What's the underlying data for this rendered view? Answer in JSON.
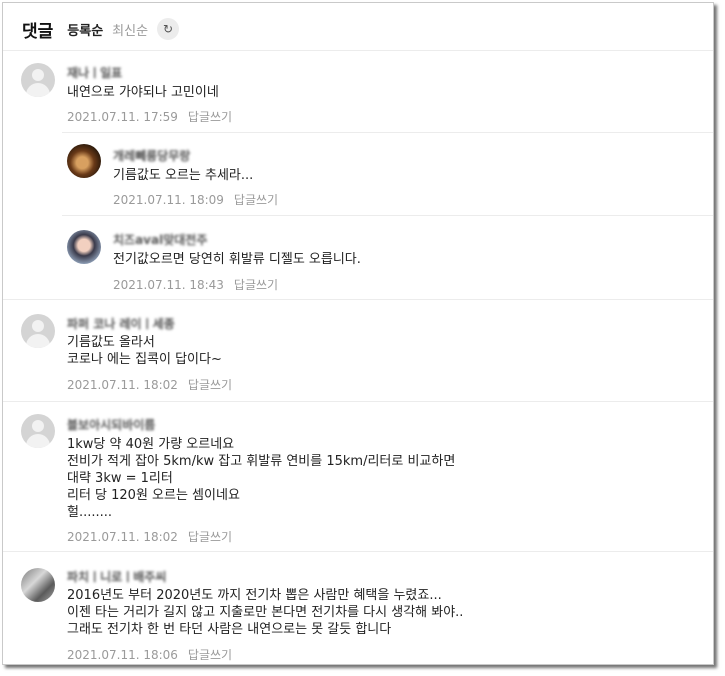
{
  "header": {
    "title": "댓글",
    "sort_registered": "등록순",
    "sort_latest": "최신순",
    "refresh_icon": "refresh-icon"
  },
  "reply_label": "답글쓰기",
  "comments": [
    {
      "nickname": "재나ㅣ일표",
      "lines": [
        "내연으로 가야되나 고민이네"
      ],
      "date": "2021.07.11. 17:59"
    },
    {
      "nickname": "개레뻬릉당무랑",
      "lines": [
        "기름값도 오르는 추세라..."
      ],
      "date": "2021.07.11. 18:09"
    },
    {
      "nickname": "치즈aval맞대전주",
      "lines": [
        "전기값오르면 당연히 휘발류 디젤도 오릅니다."
      ],
      "date": "2021.07.11. 18:43"
    },
    {
      "nickname": "파퍼 코나 레이ㅣ세종",
      "lines": [
        "기름값도 올라서",
        "코로나 에는 집콕이 답이다~"
      ],
      "date": "2021.07.11. 18:02"
    },
    {
      "nickname": "블보아시되바이름",
      "lines": [
        "1kw당 약 40원 가량 오르네요",
        "전비가 적게 잡아 5km/kw 잡고 휘발류 연비를 15km/리터로 비교하면",
        "대략 3kw = 1리터",
        "리터 당 120원 오르는 셈이네요",
        "헐........"
      ],
      "date": "2021.07.11. 18:02"
    },
    {
      "nickname": "파치ㅣ니로ㅣ배주씨",
      "lines": [
        "2016년도 부터 2020년도 까지 전기차 뽑은 사람만 혜택을 누렸죠...",
        "이젠 타는 거리가 길지 않고 지출로만 본다면 전기차를 다시 생각해 봐야..",
        "그래도 전기차 한 번 타던 사람은 내연으로는 못 갈듯 합니다"
      ],
      "date": "2021.07.11. 18:06"
    }
  ]
}
